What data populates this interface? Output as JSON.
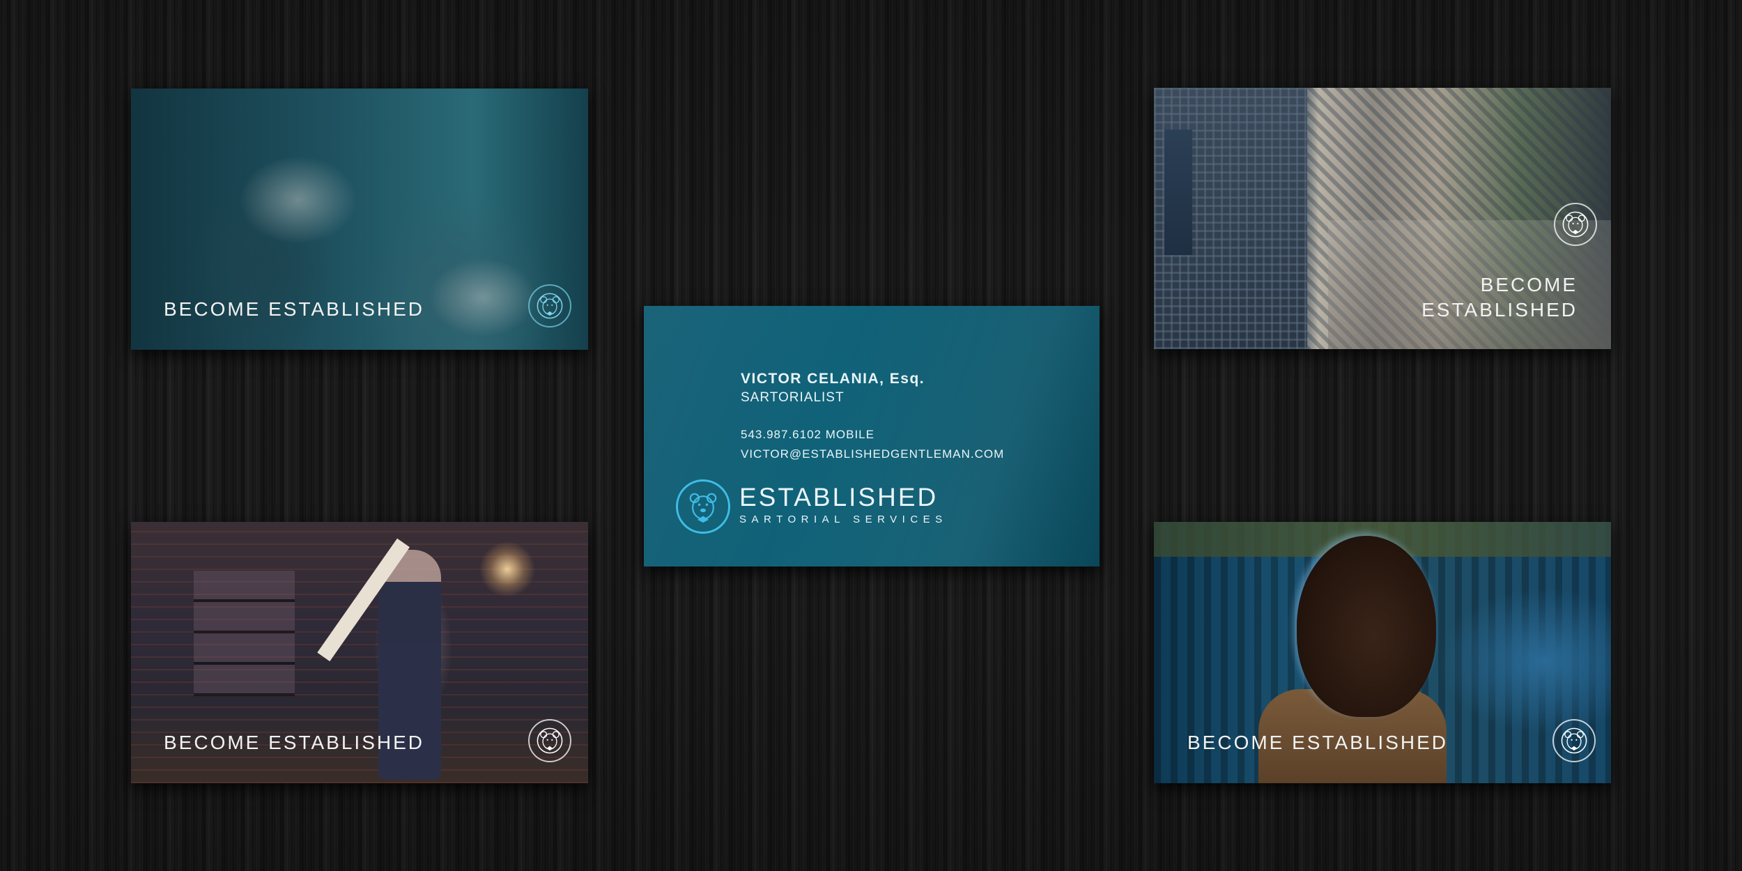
{
  "cards": {
    "top_left": {
      "tagline": "BECOME ESTABLISHED"
    },
    "top_right": {
      "tagline_line1": "BECOME",
      "tagline_line2": "ESTABLISHED"
    },
    "bottom_left": {
      "tagline": "BECOME ESTABLISHED"
    },
    "bottom_right": {
      "tagline": "BECOME ESTABLISHED"
    },
    "center": {
      "name": "VICTOR CELANIA, Esq.",
      "title": "SARTORIALIST",
      "phone": "543.987.6102 MOBILE",
      "email": "VICTOR@ESTABLISHEDGENTLEMAN.COM",
      "brand": "ESTABLISHED",
      "brand_sub": "SARTORIAL SERVICES"
    }
  },
  "colors": {
    "teal_card": "#0e5a71",
    "logo_blue": "#3fbde6",
    "text_light": "#eaf5f8"
  },
  "icons": [
    "bear-crest-icon"
  ]
}
